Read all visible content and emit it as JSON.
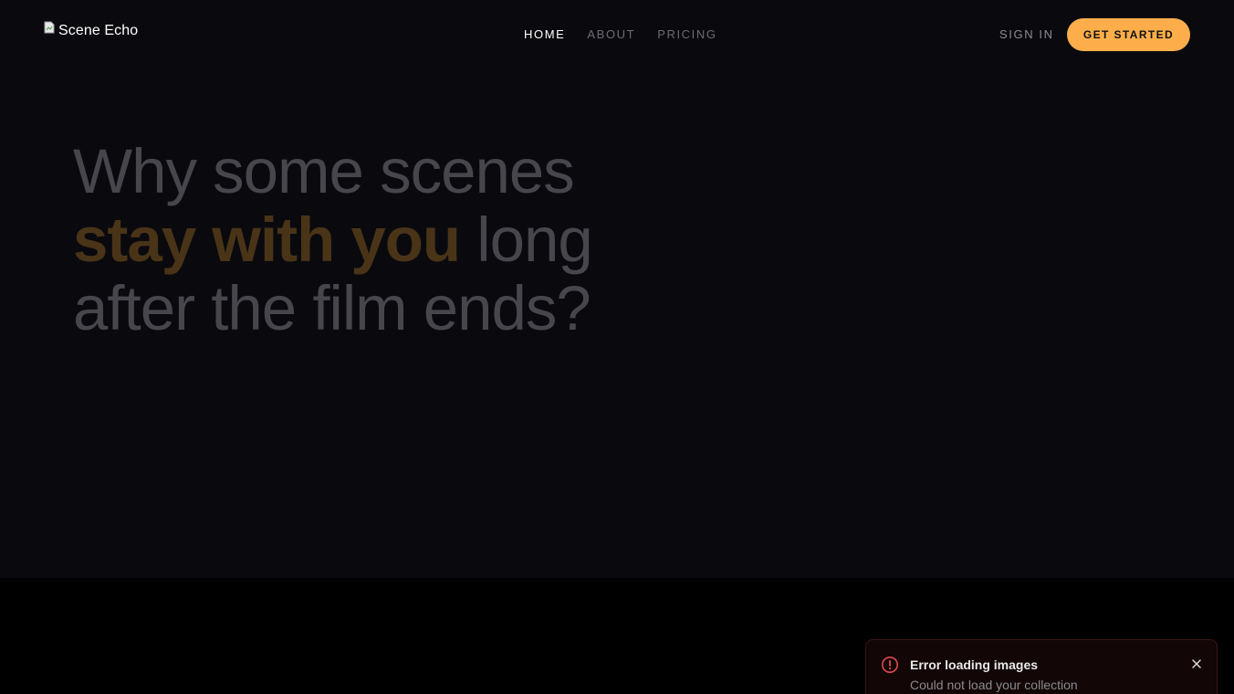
{
  "header": {
    "logo_alt": "Scene Echo",
    "nav": [
      {
        "label": "HOME"
      },
      {
        "label": "ABOUT"
      },
      {
        "label": "PRICING"
      }
    ],
    "sign_in_label": "SIGN IN",
    "cta_label": "GET STARTED"
  },
  "hero": {
    "line1": "Why some scenes",
    "line2_accent": "stay with you",
    "line2_rest": " long",
    "line3": "after the film ends?"
  },
  "toast": {
    "title": "Error loading images",
    "description": "Could not load your collection",
    "icon": "alert-circle-icon",
    "accent_color": "#e5484d"
  },
  "colors": {
    "brand": "#fdae4b",
    "hero_bg": "#0a0a0e",
    "page_bg": "#000000"
  }
}
